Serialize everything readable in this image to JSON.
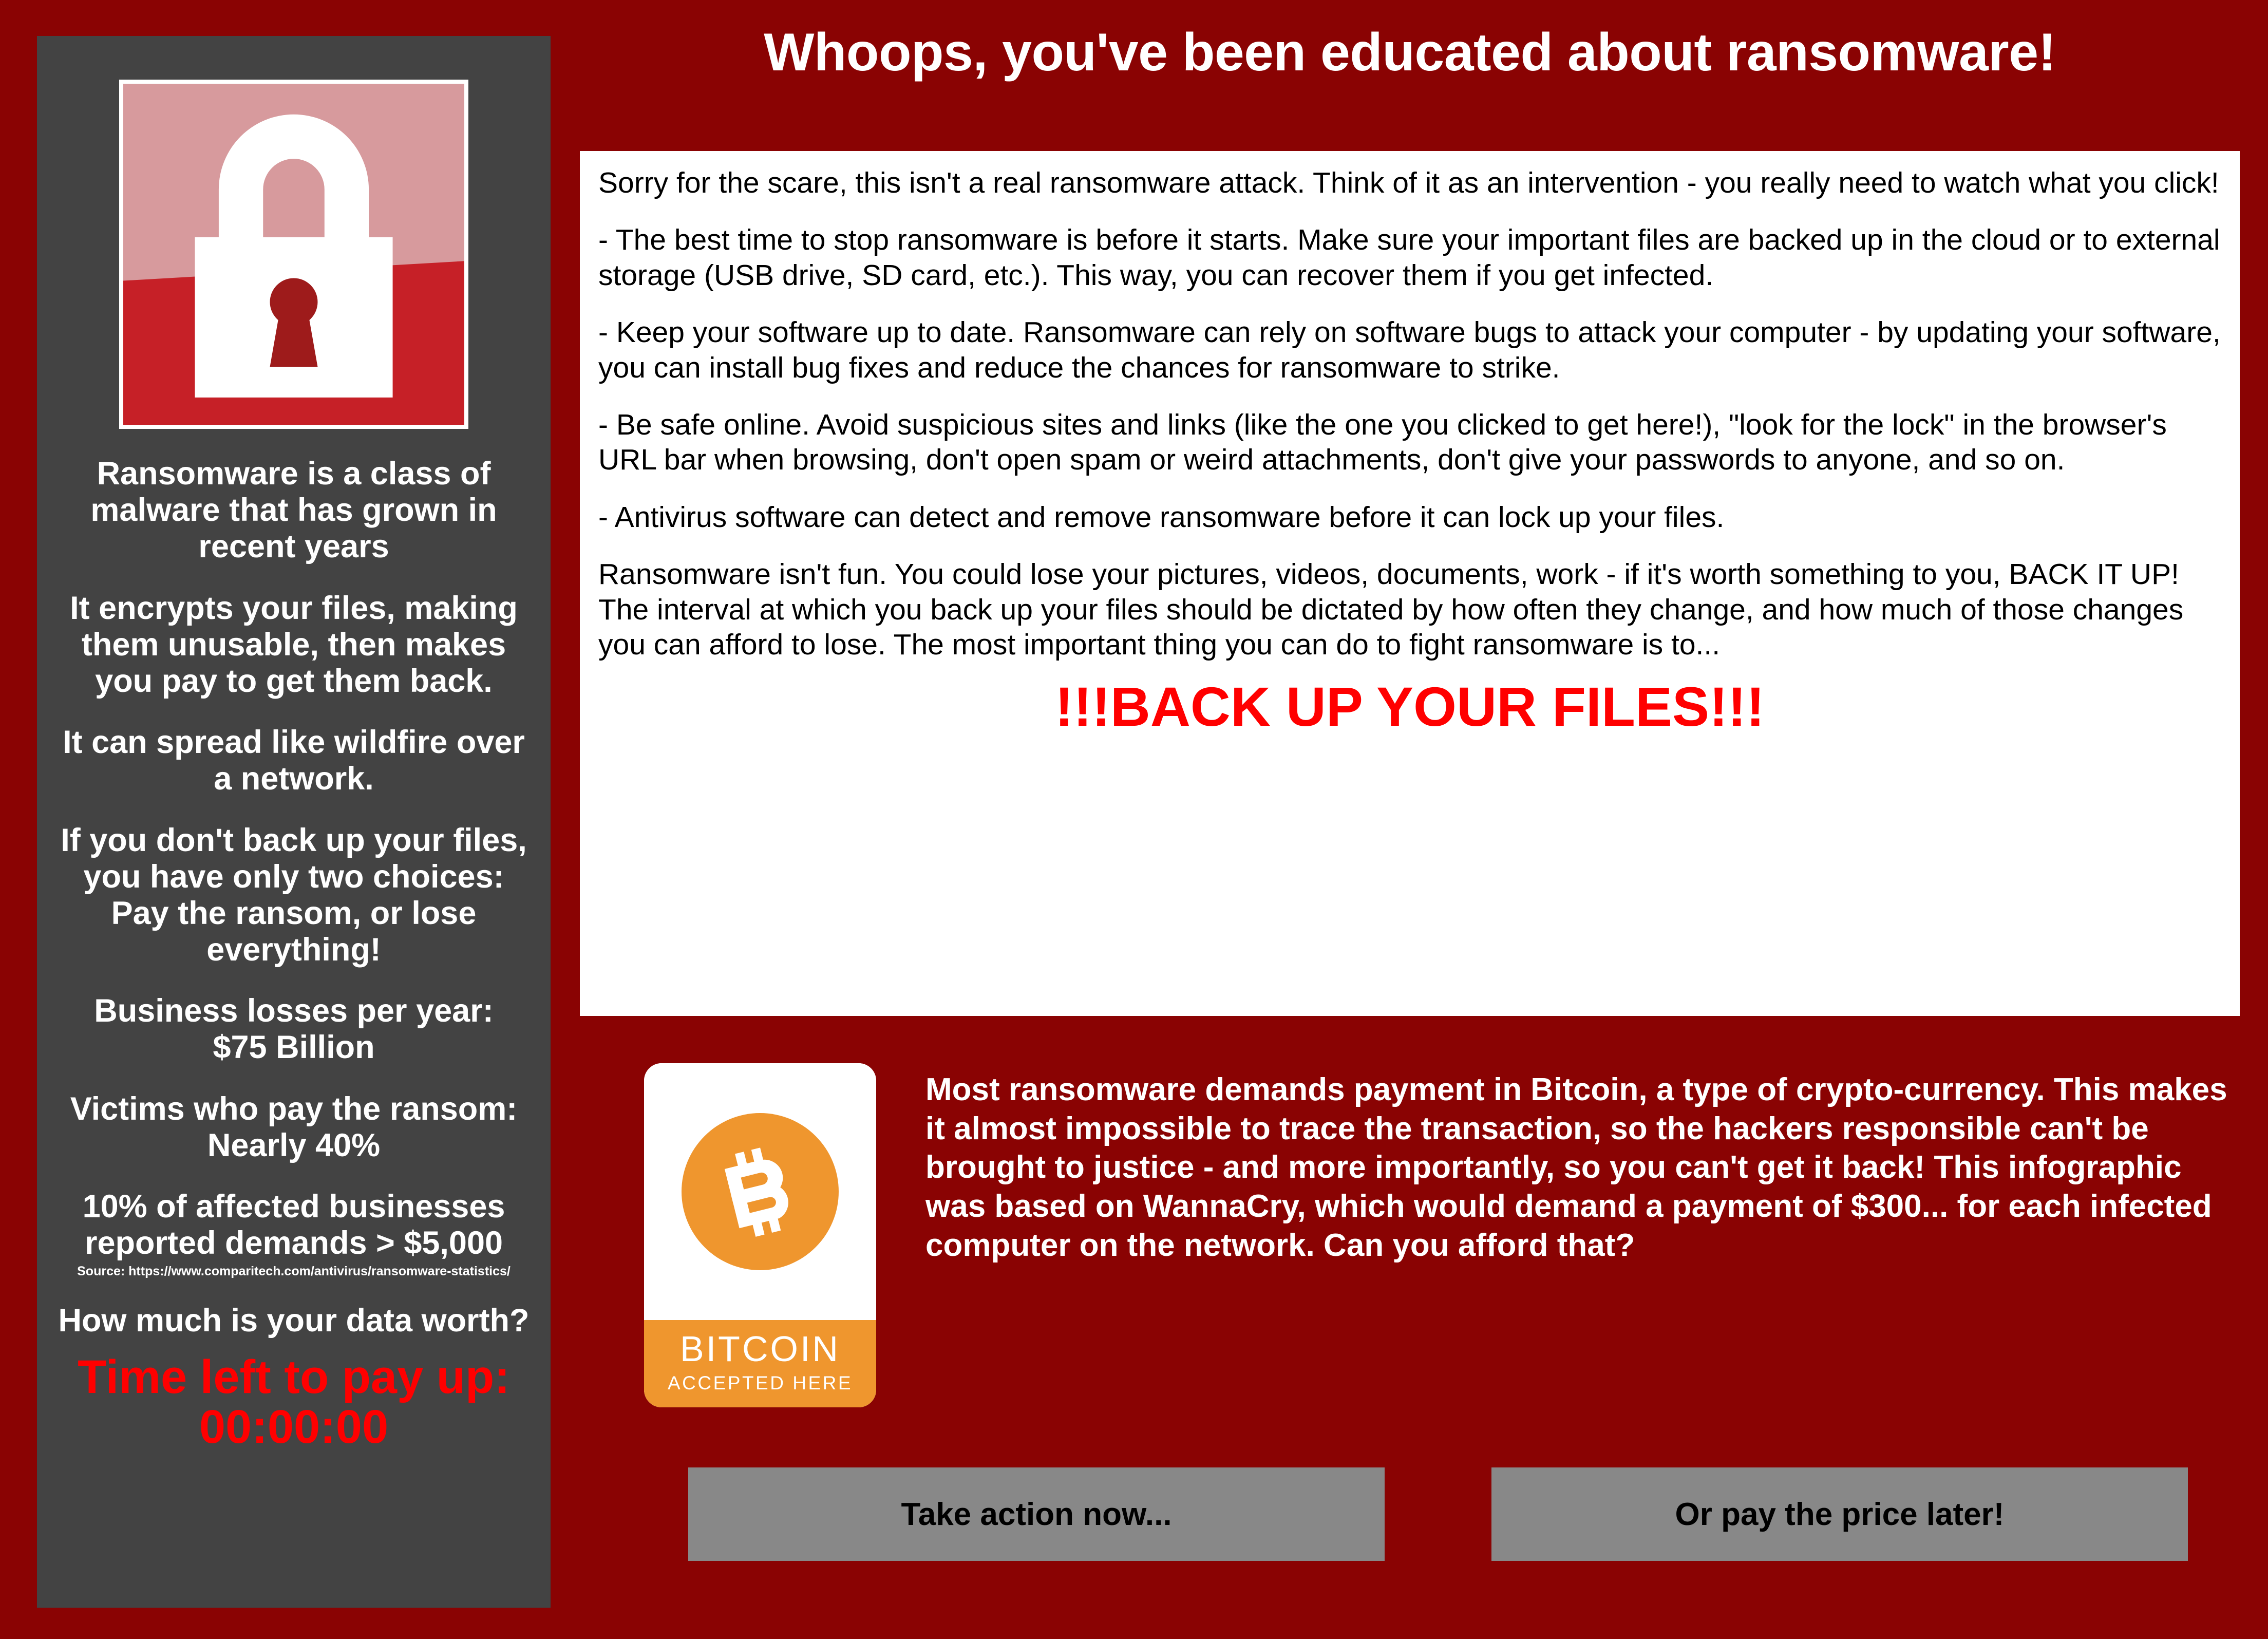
{
  "headline": "Whoops, you've been educated about ransomware!",
  "colors": {
    "background_red": "#8a0303",
    "sidebar_gray": "#434343",
    "alert_red": "#ff0000",
    "bitcoin_orange": "#ef962e",
    "button_gray": "#888888",
    "panel_white": "#ffffff"
  },
  "sidebar": {
    "lock_icon_name": "padlock-icon",
    "paragraphs": [
      "Ransomware is a class of malware that has grown in recent years",
      "It encrypts your files, making them unusable, then makes you pay to get them back.",
      "It can spread like wildfire over a network.",
      "If you don't back up your files, you have only two choices:\nPay the ransom, or lose everything!",
      "Business losses per year:\n$75 Billion",
      "Victims who pay the ransom:\nNearly 40%",
      "10% of affected businesses reported demands > $5,000"
    ],
    "source": "Source: https://www.comparitech.com/antivirus/ransomware-statistics/",
    "question": "How much is your data worth?",
    "timer_label": "Time left to pay up:",
    "timer_value": "00:00:00"
  },
  "white_panel": {
    "paragraphs": [
      "Sorry for the scare, this isn't a real ransomware attack. Think of it as an intervention - you really need to watch what you click!",
      "- The best time to stop ransomware is before it starts. Make sure your important files are backed up in the cloud or to external storage (USB drive, SD card, etc.). This way, you can recover them if you get infected.",
      "- Keep your software up to date. Ransomware can rely on software bugs to attack your computer - by updating your software, you can install bug fixes and reduce the chances for ransomware to strike.",
      "- Be safe online. Avoid suspicious sites and links (like the one you clicked to get here!), \"look for the lock\" in the browser's URL bar when browsing, don't open spam or weird attachments, don't give your passwords to anyone, and so on.",
      "- Antivirus software can detect and remove ransomware before it can lock up your files.",
      "Ransomware isn't fun. You could lose your pictures, videos, documents, work - if it's worth something to you, BACK IT UP! The interval at which you back up your files should be dictated by how often they change, and how much of those changes you can afford to lose. The most important thing you can do to fight ransomware is to..."
    ],
    "shout": "!!!BACK UP YOUR FILES!!!"
  },
  "bitcoin": {
    "icon_name": "bitcoin-coin-icon",
    "badge_title": "BITCOIN",
    "badge_subtitle": "ACCEPTED HERE",
    "text": "Most ransomware demands payment in Bitcoin, a type of crypto-currency. This makes it almost impossible to trace the transaction, so the hackers responsible can't be brought to justice - and more importantly, so you can't get it back! This infographic was based on WannaCry, which would demand a payment of $300... for each infected computer on the network. Can you afford that?"
  },
  "buttons": {
    "primary": "Take action now...",
    "secondary": "Or pay the price later!"
  }
}
